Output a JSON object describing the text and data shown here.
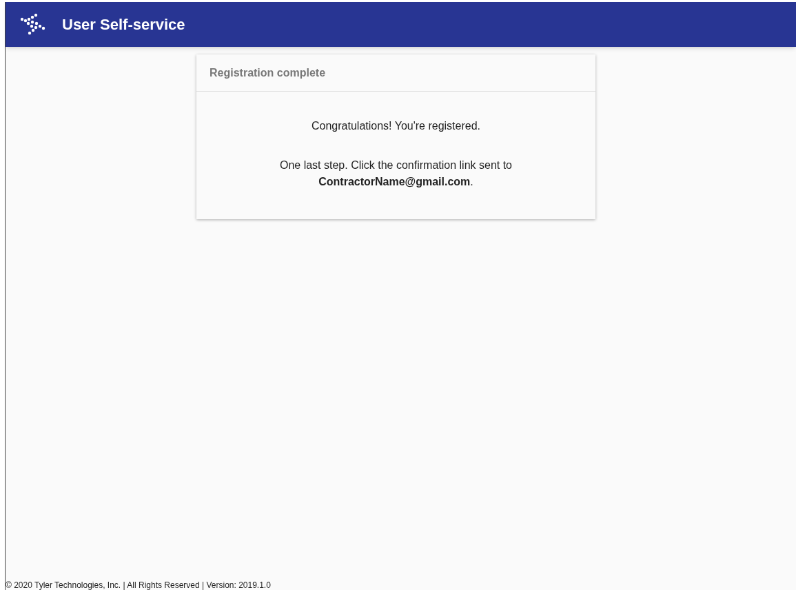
{
  "header": {
    "title": "User Self-service"
  },
  "card": {
    "title": "Registration complete",
    "messages": [
      "Congratulations! You're registered.",
      "One last step. Click the confirmation link sent to **ContractorName@gmail.com**."
    ]
  },
  "footer": {
    "text": "© 2020 Tyler Technologies, Inc. | All Rights Reserved | Version: 2019.1.0"
  }
}
